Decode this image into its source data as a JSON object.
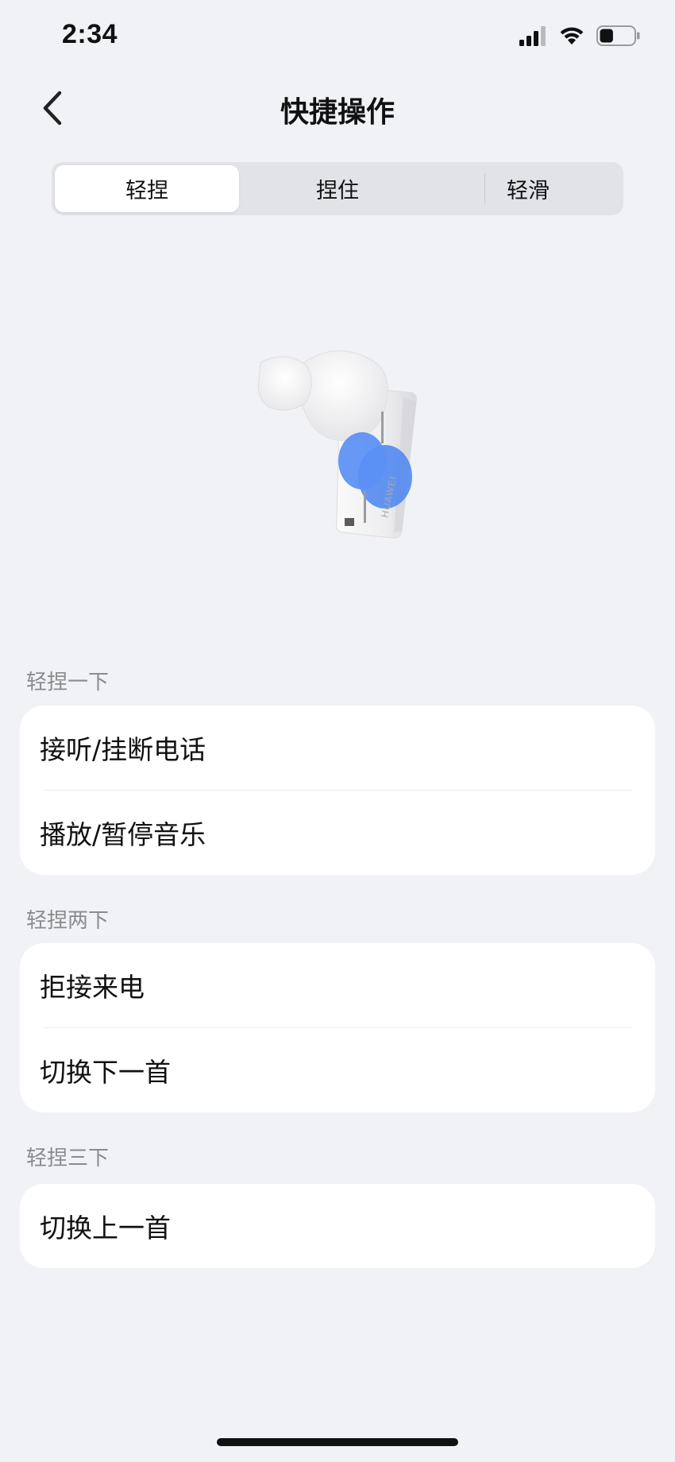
{
  "status_bar": {
    "time": "2:34",
    "battery_level": 0.4,
    "icons": [
      "signal-icon",
      "wifi-icon",
      "battery-icon"
    ]
  },
  "nav": {
    "title": "快捷操作",
    "back_icon": "chevron-left-icon"
  },
  "tabs": [
    {
      "label": "轻捏",
      "active": true
    },
    {
      "label": "捏住",
      "active": false
    },
    {
      "label": "轻滑",
      "active": false
    }
  ],
  "illustration": {
    "brand_text": "HUAWEI",
    "highlight_color": "#4f86f0"
  },
  "sections": [
    {
      "label": "轻捏一下",
      "items": [
        "接听/挂断电话",
        "播放/暂停音乐"
      ]
    },
    {
      "label": "轻捏两下",
      "items": [
        "拒接来电",
        "切换下一首"
      ]
    },
    {
      "label": "轻捏三下",
      "items": [
        "切换上一首"
      ]
    }
  ],
  "colors": {
    "background": "#f1f2f5",
    "card": "#ffffff",
    "section_label": "#8a8b90",
    "segment_track": "#e2e3e7"
  }
}
